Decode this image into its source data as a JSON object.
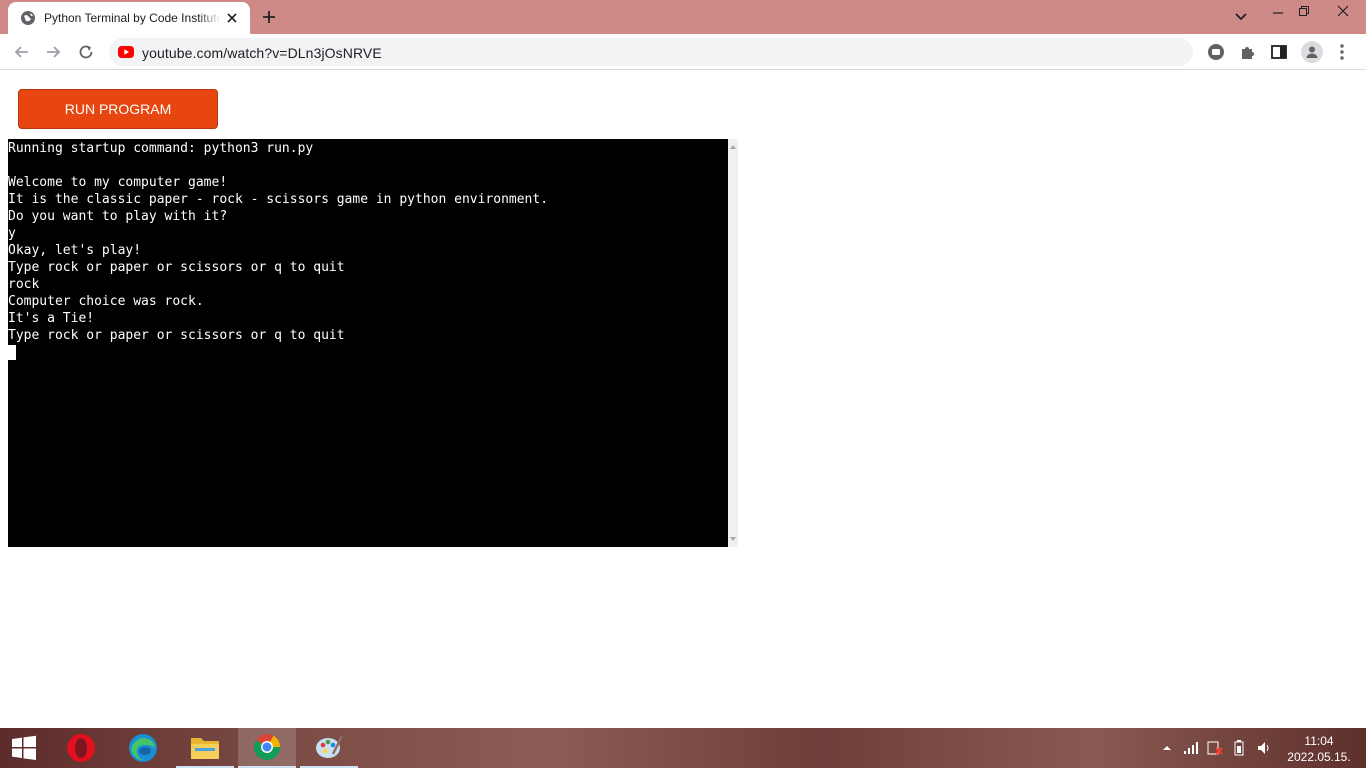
{
  "browser": {
    "tab": {
      "title": "Python Terminal by Code Institute",
      "favicon": "globe-icon"
    },
    "url": "youtube.com/watch?v=DLn3jOsNRVE"
  },
  "page": {
    "run_button_label": "RUN PROGRAM",
    "terminal": {
      "lines": [
        "Running startup command: python3 run.py",
        "",
        "Welcome to my computer game!",
        "It is the classic paper - rock - scissors game in python environment.",
        "Do you want to play with it?",
        "y",
        "Okay, let's play!",
        "Type rock or paper or scissors or q to quit",
        "rock",
        "Computer choice was rock.",
        "It's a Tie!",
        "Type rock or paper or scissors or q to quit"
      ]
    }
  },
  "taskbar": {
    "apps": [
      "opera",
      "edge",
      "file-explorer",
      "chrome",
      "paint"
    ],
    "clock": {
      "time": "11:04",
      "date": "2022.05.15."
    }
  },
  "colors": {
    "tab_strip": "#cd8a86",
    "run_button": "#e84610",
    "terminal_bg": "#000000",
    "terminal_fg": "#ffffff"
  }
}
